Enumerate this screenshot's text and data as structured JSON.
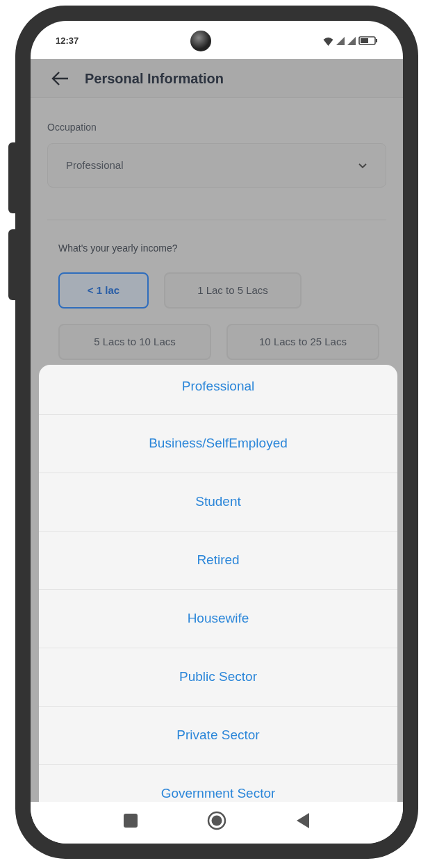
{
  "status_bar": {
    "time": "12:37"
  },
  "header": {
    "title": "Personal Information"
  },
  "occupation": {
    "label": "Occupation",
    "value": "Professional"
  },
  "income": {
    "question": "What's your yearly income?",
    "options": [
      {
        "label": "< 1 lac",
        "selected": true
      },
      {
        "label": "1 Lac to 5 Lacs",
        "selected": false
      },
      {
        "label": "5 Lacs to 10 Lacs",
        "selected": false
      },
      {
        "label": "10 Lacs to 25 Lacs",
        "selected": false
      }
    ]
  },
  "occupation_sheet": {
    "options": [
      "Professional",
      "Business/SelfEmployed",
      "Student",
      "Retired",
      "Housewife",
      "Public Sector",
      "Private Sector",
      "Government Sector"
    ]
  }
}
